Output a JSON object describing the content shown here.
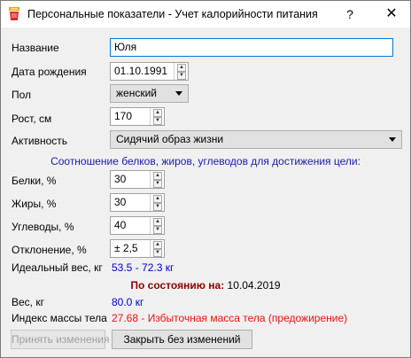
{
  "window": {
    "title": "Персональные показатели - Учет калорийности питания",
    "help_glyph": "?",
    "close_glyph": "✕"
  },
  "form": {
    "name": {
      "label": "Название",
      "value": "Юля"
    },
    "birth_date": {
      "label": "Дата рождения",
      "value": "01.10.1991"
    },
    "gender": {
      "label": "Пол",
      "value": "женский"
    },
    "height": {
      "label": "Рост, см",
      "value": "170"
    },
    "activity": {
      "label": "Активность",
      "value": "Сидячий образ жизни"
    },
    "ratio_heading": "Соотношение белков, жиров, углеводов для достижения цели:",
    "proteins": {
      "label": "Белки, %",
      "value": "30"
    },
    "fats": {
      "label": "Жиры, %",
      "value": "30"
    },
    "carbs": {
      "label": "Углеводы, %",
      "value": "40"
    },
    "deviation": {
      "label": "Отклонение, %",
      "value": "± 2,5"
    },
    "ideal_weight": {
      "label": "Идеальный вес, кг",
      "value": "53.5 - 72.3 кг"
    },
    "status": {
      "label": "По состоянию на:",
      "date": "10.04.2019"
    },
    "weight": {
      "label": "Вес, кг",
      "value": "80.0 кг"
    },
    "bmi": {
      "label": "Индекс массы тела",
      "value": "27.68 - Избыточная масса тела (предожирение)"
    }
  },
  "buttons": {
    "apply": "Принять изменения",
    "close": "Закрыть без изменений"
  },
  "colors": {
    "link_blue": "#0000c8",
    "warning_red": "#e81010",
    "status_maroon": "#8b0000",
    "focus_border": "#0078d7"
  }
}
